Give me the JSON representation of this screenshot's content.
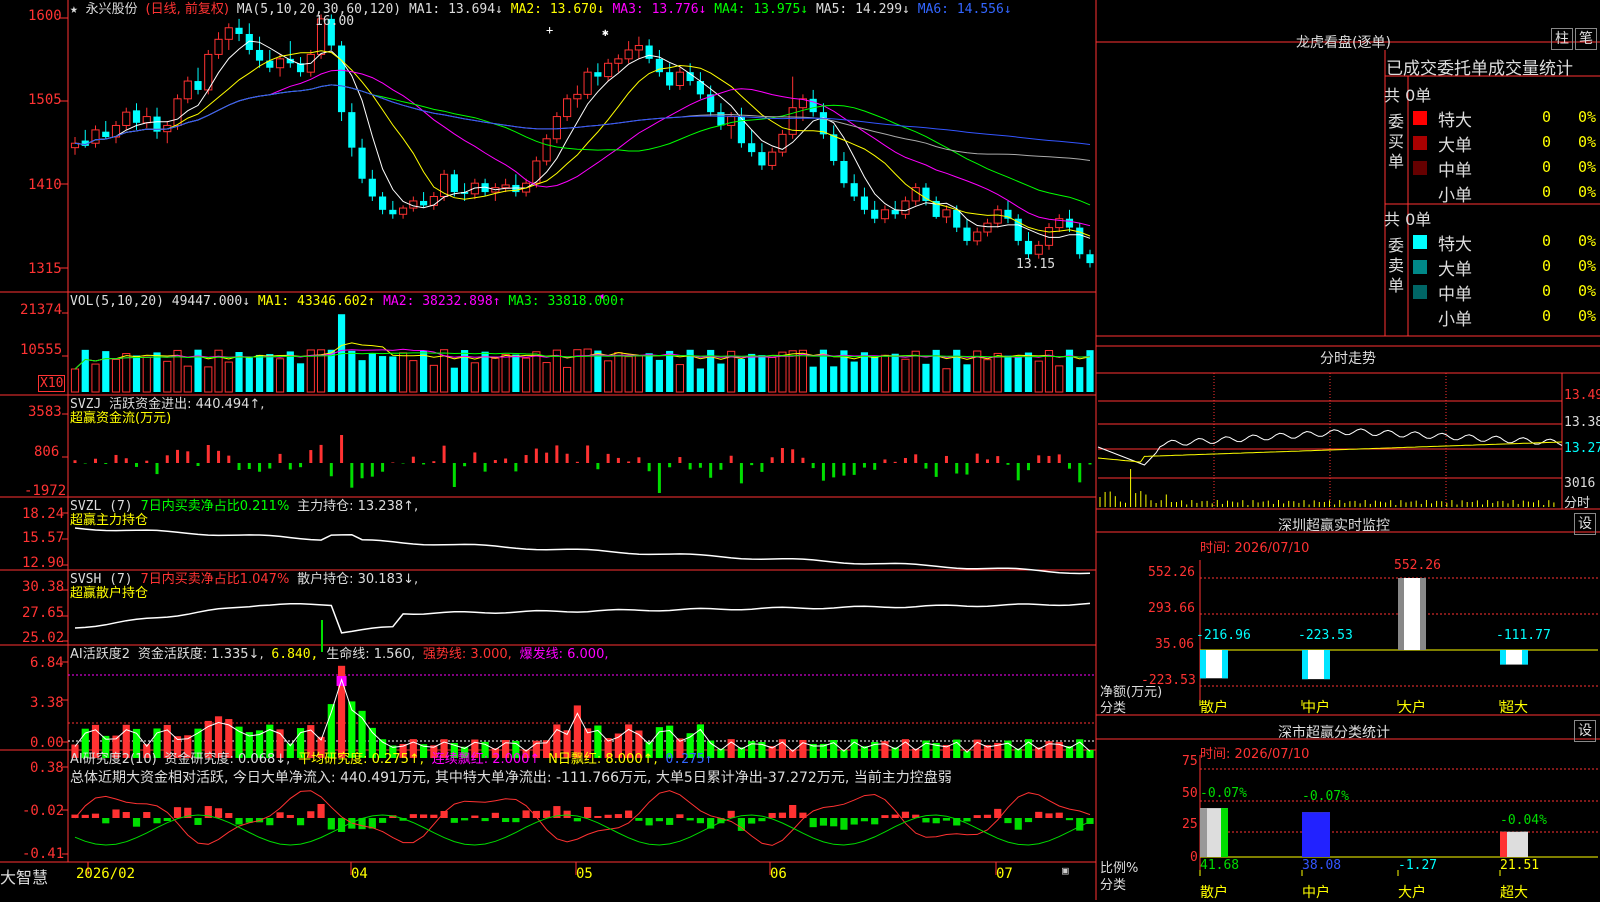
{
  "stock": {
    "name": "永兴股份",
    "mode": "(日线, 前复权)",
    "star": "★"
  },
  "ma_legend": {
    "label": "MA(5,10,20,30,60,120)",
    "ma1": "MA1: 13.694↓",
    "ma2": "MA2: 13.670↓",
    "ma3": "MA3: 13.776↓",
    "ma4": "MA4: 13.975↓",
    "ma5": "MA5: 14.299↓",
    "ma6": "MA6: 14.556↓"
  },
  "price_axis": [
    "1600",
    "1505",
    "1410",
    "1315"
  ],
  "price_marks": {
    "high": "16.00",
    "low": "13.15"
  },
  "vol_legend": {
    "label": "VOL(5,10,20)",
    "value": "49447.000↓",
    "ma1": "MA1: 43346.602↑",
    "ma2": "MA2: 38232.898↑",
    "ma3": "MA3: 33818.000↑"
  },
  "vol_axis": [
    "21374",
    "10555"
  ],
  "vol_unit": "X10",
  "svzj": {
    "label": "SVZJ",
    "text": "活跃资金进出: 440.494↑,",
    "sub": "超赢资金流(万元)",
    "axis": [
      "3583",
      "806",
      "-1972"
    ]
  },
  "svzl": {
    "label": "SVZL (7)",
    "text": "7日内买卖净占比0.211%",
    "text2": "主力持仓: 13.238↑,",
    "sub": "超赢主力持仓",
    "axis": [
      "18.24",
      "15.57",
      "12.90"
    ]
  },
  "svsh": {
    "label": "SVSH (7)",
    "text": "7日内买卖净占比1.047%",
    "text2": "散户持仓: 30.183↓,",
    "sub": "超赢散户持仓",
    "axis": [
      "30.38",
      "27.65",
      "25.02"
    ]
  },
  "ai_hy": {
    "label": "AI活跃度2",
    "t1": "资金活跃度: 1.335↓,",
    "t2": "6.840,",
    "t3": "生命线: 1.560,",
    "t4": "强势线: 3.000,",
    "t5": "爆发线: 6.000,",
    "axis": [
      "6.84",
      "3.38",
      "0.00"
    ]
  },
  "ai_yj": {
    "label": "AI研究度2(10)",
    "t1": "资金研究度: 0.068↓,",
    "t2": "平均研究度: 0.275↑,",
    "t3": "连续飘红: 2.000↑",
    "t4": "N日飘红: 8.000↑,",
    "t5": "0.275↑",
    "comment": "总体近期大资金相对活跃, 今日大单净流入: 440.491万元, 其中特大单净流出: -111.766万元, 大单5日累计净出-37.272万元, 当前主力控盘弱",
    "axis": [
      "0.38",
      "-0.02",
      "-0.41"
    ]
  },
  "dates": [
    "2026/02",
    "04",
    "05",
    "06",
    "07"
  ],
  "brand": "大智慧",
  "right": {
    "title": "龙虎看盘(逐单)",
    "btn1": "柱",
    "btn2": "笔",
    "tabs": "已成交委托单成交量统计",
    "buy": {
      "head": "委买单",
      "total": "共 0单",
      "rows": [
        {
          "label": "特大",
          "v": "0",
          "p": "0%",
          "color": "#ff0000"
        },
        {
          "label": "大单",
          "v": "0",
          "p": "0%",
          "color": "#aa0000"
        },
        {
          "label": "中单",
          "v": "0",
          "p": "0%",
          "color": "#660000"
        },
        {
          "label": "小单",
          "v": "0",
          "p": "0%",
          "color": ""
        }
      ]
    },
    "sell": {
      "head": "委卖单",
      "total": "共 0单",
      "rows": [
        {
          "label": "特大",
          "v": "0",
          "p": "0%",
          "color": "#00ffff"
        },
        {
          "label": "大单",
          "v": "0",
          "p": "0%",
          "color": "#008888"
        },
        {
          "label": "中单",
          "v": "0",
          "p": "0%",
          "color": "#006666"
        },
        {
          "label": "小单",
          "v": "0",
          "p": "0%",
          "color": ""
        }
      ]
    },
    "fs": {
      "title": "分时走势",
      "axis": [
        "13.49",
        "13.38",
        "13.27"
      ],
      "vol": "3016",
      "unit": "分时"
    },
    "monitor": {
      "title": "深圳超赢实时监控",
      "btn": "设",
      "time": "时间: 2026/07/10",
      "axis": [
        "552.26",
        "293.66",
        "35.06",
        "-223.53"
      ],
      "ylabel": "净额(万元)",
      "xlabel": "分类",
      "cats": [
        "散户",
        "中户",
        "大户",
        "超大"
      ],
      "values": [
        "-216.96",
        "-223.53",
        "552.26",
        "-111.77"
      ]
    },
    "classify": {
      "title": "深市超赢分类统计",
      "btn": "设",
      "time": "时间: 2026/07/10",
      "axis": [
        "75",
        "50",
        "25",
        "0"
      ],
      "ylabel": "比例%",
      "xlabel": "分类",
      "cats": [
        "散户",
        "中户",
        "大户",
        "超大"
      ],
      "top": [
        "-0.07%",
        "-0.07%",
        "",
        "-0.04%"
      ],
      "bottom": [
        "41.68",
        "38.08",
        "-1.27",
        "21.51"
      ]
    }
  },
  "chart_data": {
    "type": "candlestick",
    "note_series": "daily candles approximate",
    "ohlc": [
      [
        14.5,
        14.62,
        14.42,
        14.55
      ],
      [
        14.58,
        14.7,
        14.5,
        14.52
      ],
      [
        14.55,
        14.75,
        14.5,
        14.7
      ],
      [
        14.68,
        14.8,
        14.6,
        14.62
      ],
      [
        14.62,
        14.8,
        14.55,
        14.75
      ],
      [
        14.75,
        14.95,
        14.7,
        14.9
      ],
      [
        14.92,
        15.0,
        14.7,
        14.78
      ],
      [
        14.78,
        14.95,
        14.72,
        14.85
      ],
      [
        14.85,
        14.95,
        14.6,
        14.68
      ],
      [
        14.68,
        14.8,
        14.55,
        14.75
      ],
      [
        14.75,
        15.1,
        14.7,
        15.05
      ],
      [
        15.05,
        15.3,
        15.0,
        15.25
      ],
      [
        15.25,
        15.4,
        15.1,
        15.15
      ],
      [
        15.15,
        15.6,
        15.1,
        15.55
      ],
      [
        15.55,
        15.8,
        15.5,
        15.72
      ],
      [
        15.72,
        15.9,
        15.6,
        15.85
      ],
      [
        15.85,
        15.95,
        15.7,
        15.78
      ],
      [
        15.78,
        15.9,
        15.55,
        15.6
      ],
      [
        15.6,
        15.75,
        15.4,
        15.48
      ],
      [
        15.48,
        15.6,
        15.35,
        15.4
      ],
      [
        15.4,
        15.55,
        15.3,
        15.5
      ],
      [
        15.5,
        15.7,
        15.4,
        15.45
      ],
      [
        15.45,
        15.52,
        15.3,
        15.35
      ],
      [
        15.35,
        15.6,
        15.3,
        15.55
      ],
      [
        15.55,
        16.0,
        15.5,
        15.95
      ],
      [
        15.95,
        16.0,
        15.6,
        15.65
      ],
      [
        15.65,
        15.7,
        14.8,
        14.9
      ],
      [
        14.9,
        15.0,
        14.4,
        14.5
      ],
      [
        14.5,
        14.6,
        14.1,
        14.15
      ],
      [
        14.15,
        14.25,
        13.9,
        13.95
      ],
      [
        13.95,
        14.0,
        13.75,
        13.8
      ],
      [
        13.8,
        13.9,
        13.7,
        13.75
      ],
      [
        13.75,
        13.85,
        13.7,
        13.82
      ],
      [
        13.82,
        13.95,
        13.78,
        13.9
      ],
      [
        13.9,
        14.0,
        13.82,
        13.85
      ],
      [
        13.85,
        14.0,
        13.8,
        13.95
      ],
      [
        13.95,
        14.25,
        13.9,
        14.2
      ],
      [
        14.2,
        14.25,
        13.95,
        14.0
      ],
      [
        14.0,
        14.1,
        13.9,
        13.98
      ],
      [
        13.98,
        14.15,
        13.92,
        14.1
      ],
      [
        14.1,
        14.15,
        13.95,
        14.0
      ],
      [
        14.0,
        14.1,
        13.9,
        14.05
      ],
      [
        14.05,
        14.15,
        14.0,
        14.08
      ],
      [
        14.08,
        14.2,
        13.95,
        14.0
      ],
      [
        14.0,
        14.15,
        13.95,
        14.1
      ],
      [
        14.1,
        14.4,
        14.05,
        14.35
      ],
      [
        14.35,
        14.65,
        14.3,
        14.6
      ],
      [
        14.6,
        14.9,
        14.55,
        14.85
      ],
      [
        14.85,
        15.1,
        14.8,
        15.05
      ],
      [
        15.05,
        15.2,
        14.95,
        15.1
      ],
      [
        15.1,
        15.4,
        15.05,
        15.35
      ],
      [
        15.35,
        15.45,
        15.2,
        15.3
      ],
      [
        15.3,
        15.5,
        15.25,
        15.45
      ],
      [
        15.45,
        15.55,
        15.35,
        15.5
      ],
      [
        15.5,
        15.7,
        15.45,
        15.6
      ],
      [
        15.6,
        15.75,
        15.5,
        15.65
      ],
      [
        15.65,
        15.72,
        15.45,
        15.5
      ],
      [
        15.5,
        15.6,
        15.3,
        15.35
      ],
      [
        15.35,
        15.45,
        15.15,
        15.2
      ],
      [
        15.2,
        15.4,
        15.15,
        15.35
      ],
      [
        15.35,
        15.45,
        15.2,
        15.25
      ],
      [
        15.25,
        15.35,
        15.05,
        15.1
      ],
      [
        15.1,
        15.2,
        14.85,
        14.9
      ],
      [
        14.9,
        15.0,
        14.7,
        14.75
      ],
      [
        14.75,
        14.9,
        14.6,
        14.85
      ],
      [
        14.85,
        14.95,
        14.5,
        14.55
      ],
      [
        14.55,
        14.7,
        14.4,
        14.45
      ],
      [
        14.45,
        14.55,
        14.25,
        14.3
      ],
      [
        14.3,
        14.5,
        14.25,
        14.45
      ],
      [
        14.45,
        14.7,
        14.4,
        14.65
      ],
      [
        14.65,
        15.3,
        14.6,
        14.95
      ],
      [
        14.95,
        15.1,
        14.8,
        15.05
      ],
      [
        15.05,
        15.15,
        14.85,
        14.9
      ],
      [
        14.9,
        15.0,
        14.6,
        14.65
      ],
      [
        14.65,
        14.75,
        14.3,
        14.35
      ],
      [
        14.35,
        14.45,
        14.05,
        14.1
      ],
      [
        14.1,
        14.2,
        13.9,
        13.95
      ],
      [
        13.95,
        14.05,
        13.75,
        13.8
      ],
      [
        13.8,
        13.9,
        13.65,
        13.7
      ],
      [
        13.7,
        13.85,
        13.65,
        13.8
      ],
      [
        13.8,
        13.9,
        13.7,
        13.75
      ],
      [
        13.75,
        13.95,
        13.7,
        13.9
      ],
      [
        13.9,
        14.1,
        13.85,
        14.05
      ],
      [
        14.05,
        14.1,
        13.85,
        13.9
      ],
      [
        13.9,
        13.95,
        13.7,
        13.72
      ],
      [
        13.72,
        13.85,
        13.65,
        13.8
      ],
      [
        13.8,
        13.85,
        13.55,
        13.6
      ],
      [
        13.6,
        13.7,
        13.4,
        13.45
      ],
      [
        13.45,
        13.6,
        13.4,
        13.55
      ],
      [
        13.55,
        13.7,
        13.5,
        13.65
      ],
      [
        13.65,
        13.85,
        13.6,
        13.8
      ],
      [
        13.8,
        13.9,
        13.65,
        13.7
      ],
      [
        13.7,
        13.75,
        13.4,
        13.45
      ],
      [
        13.45,
        13.55,
        13.25,
        13.3
      ],
      [
        13.3,
        13.45,
        13.25,
        13.4
      ],
      [
        13.4,
        13.65,
        13.35,
        13.6
      ],
      [
        13.6,
        13.75,
        13.55,
        13.7
      ],
      [
        13.7,
        13.8,
        13.55,
        13.6
      ],
      [
        13.6,
        13.65,
        13.25,
        13.3
      ],
      [
        13.3,
        13.35,
        13.15,
        13.2
      ]
    ]
  }
}
